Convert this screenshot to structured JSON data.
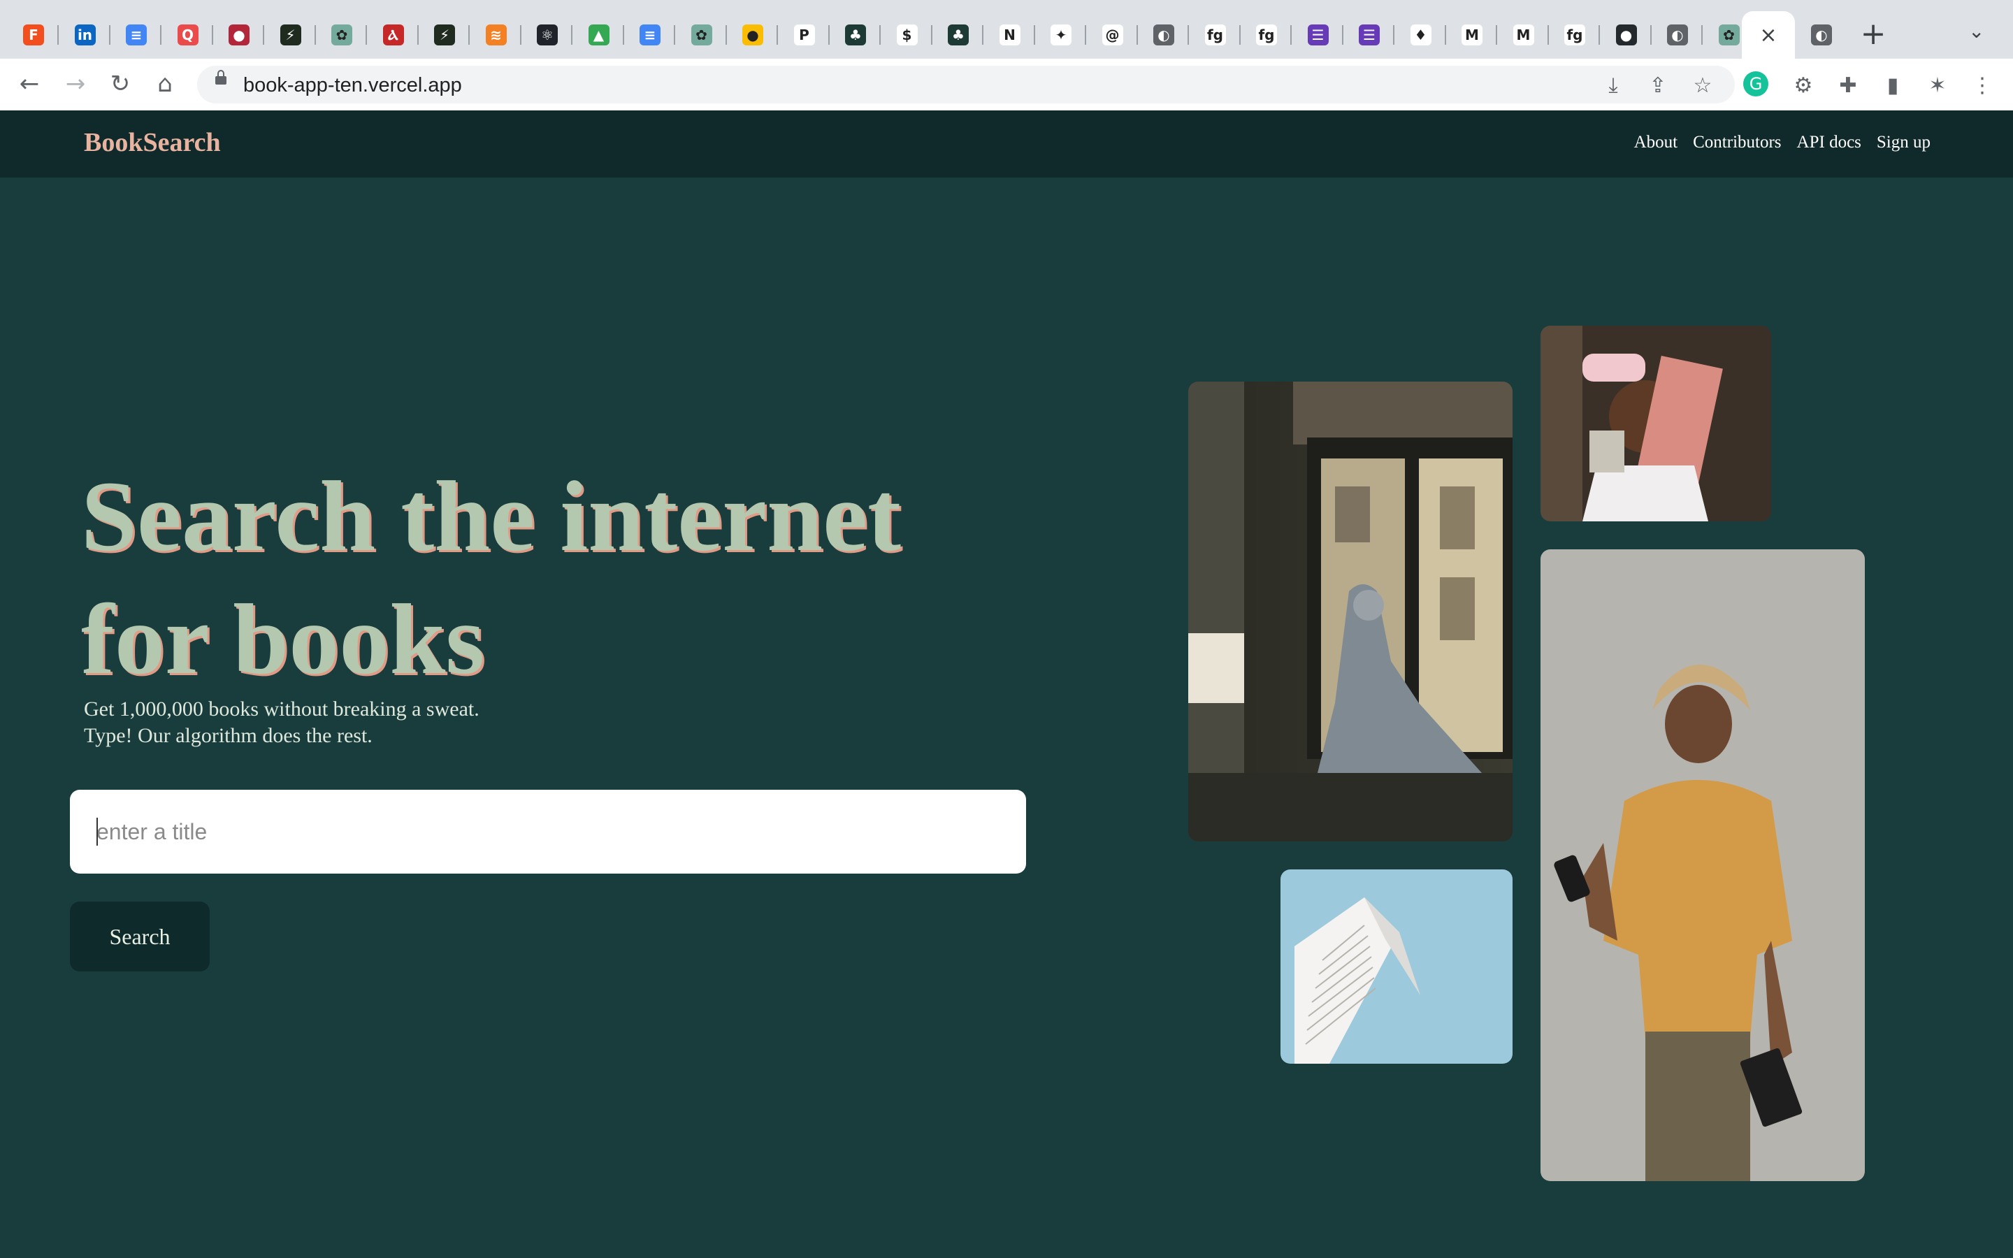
{
  "browser": {
    "tabs": [
      {
        "name": "figma",
        "color": "#f24e1e",
        "glyph": "F"
      },
      {
        "name": "linkedin",
        "color": "#0a66c2",
        "glyph": "in"
      },
      {
        "name": "google-docs",
        "color": "#4285f4",
        "glyph": "≡"
      },
      {
        "name": "quora",
        "color": "#ea4c4c",
        "glyph": "Q"
      },
      {
        "name": "avatar",
        "color": "#b3263a",
        "glyph": "●"
      },
      {
        "name": "terminal",
        "color": "#1f2b1f",
        "glyph": "⚡"
      },
      {
        "name": "chatgpt",
        "color": "#74aa9c",
        "glyph": "✿"
      },
      {
        "name": "antenna",
        "color": "#c62828",
        "glyph": "Ⲁ"
      },
      {
        "name": "terminal",
        "color": "#1f2b1f",
        "glyph": "⚡"
      },
      {
        "name": "stack-overflow",
        "color": "#f48024",
        "glyph": "≋"
      },
      {
        "name": "react",
        "color": "#20232a",
        "glyph": "⚛"
      },
      {
        "name": "google-drive",
        "color": "#34a853",
        "glyph": "▲"
      },
      {
        "name": "google-docs",
        "color": "#4285f4",
        "glyph": "≡"
      },
      {
        "name": "chatgpt",
        "color": "#74aa9c",
        "glyph": "✿"
      },
      {
        "name": "keep",
        "color": "#fbbc04",
        "glyph": "●"
      },
      {
        "name": "paypal",
        "color": "#ffffff",
        "glyph": "P"
      },
      {
        "name": "tree",
        "color": "#1e3a34",
        "glyph": "♣"
      },
      {
        "name": "dollar",
        "color": "#ffffff",
        "glyph": "$"
      },
      {
        "name": "tree",
        "color": "#1e3a34",
        "glyph": "♣"
      },
      {
        "name": "netflix",
        "color": "#ffffff",
        "glyph": "N"
      },
      {
        "name": "twitter",
        "color": "#ffffff",
        "glyph": "✦"
      },
      {
        "name": "spiral",
        "color": "#ffffff",
        "glyph": "@"
      },
      {
        "name": "globe",
        "color": "#5f6368",
        "glyph": "◐"
      },
      {
        "name": "fg",
        "color": "#ffffff",
        "glyph": "fg"
      },
      {
        "name": "fg",
        "color": "#ffffff",
        "glyph": "fg"
      },
      {
        "name": "forms",
        "color": "#673ab7",
        "glyph": "☰"
      },
      {
        "name": "forms",
        "color": "#673ab7",
        "glyph": "☰"
      },
      {
        "name": "firebase",
        "color": "#ffffff",
        "glyph": "♦"
      },
      {
        "name": "gmail",
        "color": "#ffffff",
        "glyph": "M"
      },
      {
        "name": "gmail",
        "color": "#ffffff",
        "glyph": "M"
      },
      {
        "name": "fg",
        "color": "#ffffff",
        "glyph": "fg"
      },
      {
        "name": "github",
        "color": "#24292e",
        "glyph": "●"
      },
      {
        "name": "globe",
        "color": "#5f6368",
        "glyph": "◐"
      },
      {
        "name": "chatgpt",
        "color": "#74aa9c",
        "glyph": "✿"
      }
    ],
    "active_tab_close": "×",
    "after_tab": {
      "name": "globe",
      "color": "#5f6368",
      "glyph": "◐"
    },
    "new_tab": "+",
    "tab_list": "⌄",
    "url": "book-app-ten.vercel.app"
  },
  "site": {
    "brand": "BookSearch",
    "nav": [
      "About",
      "Contributors",
      "API docs",
      "Sign up"
    ],
    "headline_line1": "Search the internet",
    "headline_line2": "for books",
    "sub_line1": "Get 1,000,000 books without breaking a sweat.",
    "sub_line2": "Type! Our algorithm does the rest.",
    "search_placeholder": "enter a title",
    "search_button": "Search",
    "colors": {
      "background": "#193d3d",
      "header": "#102a2b",
      "brand": "#e8b4a0",
      "headline": "#b3c8af"
    }
  }
}
